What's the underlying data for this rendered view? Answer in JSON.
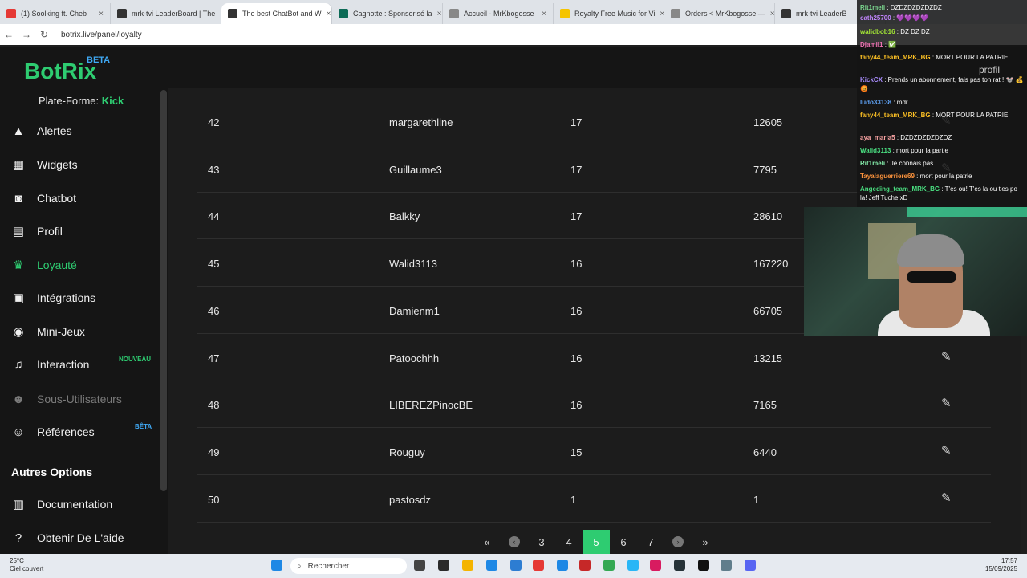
{
  "browser": {
    "tabs": [
      {
        "label": "(1) Soolking ft. Cheb",
        "color": "#e53935"
      },
      {
        "label": "mrk-tvi LeaderBoard | The",
        "color": "#333333"
      },
      {
        "label": "The best ChatBot and W",
        "color": "#333333"
      },
      {
        "label": "Cagnotte : Sponsorisé la",
        "color": "#0d6b57"
      },
      {
        "label": "Accueil - MrKbogosse",
        "color": "#888888"
      },
      {
        "label": "Royalty Free Music for Vi",
        "color": "#f5c400"
      },
      {
        "label": "Orders < MrKbogosse —",
        "color": "#888888"
      },
      {
        "label": "mrk-tvi LeaderB",
        "color": "#333333"
      }
    ],
    "url": "botrix.live/panel/loyalty"
  },
  "app": {
    "logo": "BotRix",
    "beta": "BETA",
    "platform_label": "Plate-Forme:",
    "platform_value": "Kick",
    "header_profile": "profil"
  },
  "sidebar": {
    "items": [
      {
        "label": "Alertes",
        "icon": "warning-icon"
      },
      {
        "label": "Widgets",
        "icon": "grid-icon"
      },
      {
        "label": "Chatbot",
        "icon": "robot-icon"
      },
      {
        "label": "Profil",
        "icon": "id-card-icon"
      },
      {
        "label": "Loyauté",
        "icon": "trophy-icon"
      },
      {
        "label": "Intégrations",
        "icon": "integration-icon"
      },
      {
        "label": "Mini-Jeux",
        "icon": "gamepad-icon"
      },
      {
        "label": "Interaction",
        "icon": "music-icon"
      },
      {
        "label": "Sous-Utilisateurs",
        "icon": "users-icon"
      },
      {
        "label": "Références",
        "icon": "people-icon"
      }
    ],
    "interaction_badge": "NOUVEAU",
    "references_badge": "BÊTA",
    "section_title": "Autres Options",
    "other_items": [
      {
        "label": "Documentation",
        "icon": "book-icon"
      },
      {
        "label": "Obtenir De L'aide",
        "icon": "help-icon"
      }
    ]
  },
  "leaderboard": {
    "rows": [
      {
        "rank": "42",
        "user": "margarethline",
        "level": "17",
        "points": "12605"
      },
      {
        "rank": "43",
        "user": "Guillaume3",
        "level": "17",
        "points": "7795"
      },
      {
        "rank": "44",
        "user": "Balkky",
        "level": "17",
        "points": "28610"
      },
      {
        "rank": "45",
        "user": "Walid3113",
        "level": "16",
        "points": "167220"
      },
      {
        "rank": "46",
        "user": "Damienm1",
        "level": "16",
        "points": "66705"
      },
      {
        "rank": "47",
        "user": "Patoochhh",
        "level": "16",
        "points": "13215"
      },
      {
        "rank": "48",
        "user": "LIBEREZPinocBE",
        "level": "16",
        "points": "7165"
      },
      {
        "rank": "49",
        "user": "Rouguy",
        "level": "15",
        "points": "6440"
      },
      {
        "rank": "50",
        "user": "pastosdz",
        "level": "1",
        "points": "1"
      }
    ]
  },
  "pagination": {
    "first": "«",
    "prev": "‹",
    "pages": [
      "3",
      "4",
      "5",
      "6",
      "7"
    ],
    "current": "5",
    "next": "›",
    "last": "»"
  },
  "chat": {
    "lines": [
      {
        "user": "Rit1meli",
        "text": " : DZDZDZDZDZDZ"
      },
      {
        "user": "cath25700",
        "text": " : 💜💜💜💜"
      },
      {
        "user": "walidbob16",
        "text": " : DZ DZ DZ"
      },
      {
        "user": "Djamil1",
        "text": " : ✅"
      },
      {
        "user": "fany44_team_MRK_BG",
        "text": " : MORT POUR LA PATRIE"
      },
      {
        "user": "KickCX",
        "text": " : Prends un abonnement, fais pas ton rat ! 🐭 💰 😡"
      },
      {
        "user": "ludo33138",
        "text": " : mdr"
      },
      {
        "user": "fany44_team_MRK_BG",
        "text": " : MORT POUR LA PATRIE"
      },
      {
        "user": "aya_maria5",
        "text": " : DZDZDZDZDZDZ"
      },
      {
        "user": "Walid3113",
        "text": " : mort pour la partie"
      },
      {
        "user": "Rit1meli",
        "text": " : Je connais pas"
      },
      {
        "user": "Tayalaguerriere69",
        "text": " : mort pour la patrie"
      },
      {
        "user": "Angeding_team_MRK_BG",
        "text": " : T'es ou! T'es la ou t'es po la! Jeff Tuche xD"
      }
    ]
  },
  "taskbar": {
    "temperature": "25°C",
    "weather": "Ciel couvert",
    "search_placeholder": "Rechercher",
    "time": "17:57",
    "date": "15/09/2025"
  }
}
